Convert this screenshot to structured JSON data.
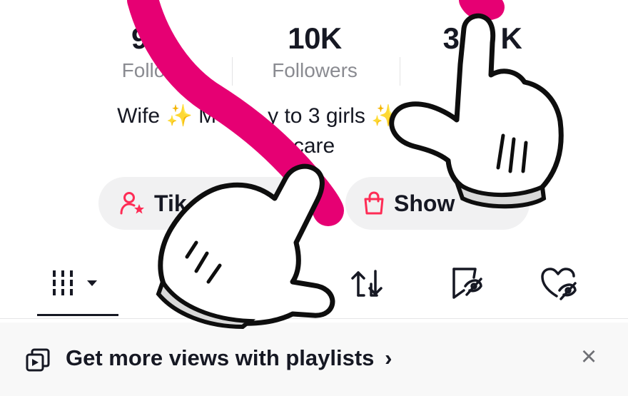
{
  "stats": [
    {
      "value": "9,",
      "label": "Follo"
    },
    {
      "value": "10K",
      "label": "Followers"
    },
    {
      "value": "3",
      "value2": "K",
      "label": ""
    }
  ],
  "bio": {
    "line1_a": "Wife",
    "line1_b": "M",
    "line1_c": "y to 3 girls",
    "line2": "care",
    "sparkle": "✨"
  },
  "buttons": {
    "tiktok_label": "Tik",
    "showcase_label": "Show"
  },
  "banner": {
    "text": "Get more views with playlists",
    "chevron": "›",
    "close": "×"
  },
  "colors": {
    "accent": "#fe2c55",
    "overlay_stroke": "#e60073"
  },
  "icons": {
    "videos_tab": "grid-icon",
    "repost_tab": "repost-icon",
    "favorites_tab": "bookmark-icon",
    "liked_tab": "heart-icon",
    "playlist": "playlist-icon",
    "tiktok_button": "user-star-icon",
    "showcase_button": "shopping-bag-icon"
  }
}
